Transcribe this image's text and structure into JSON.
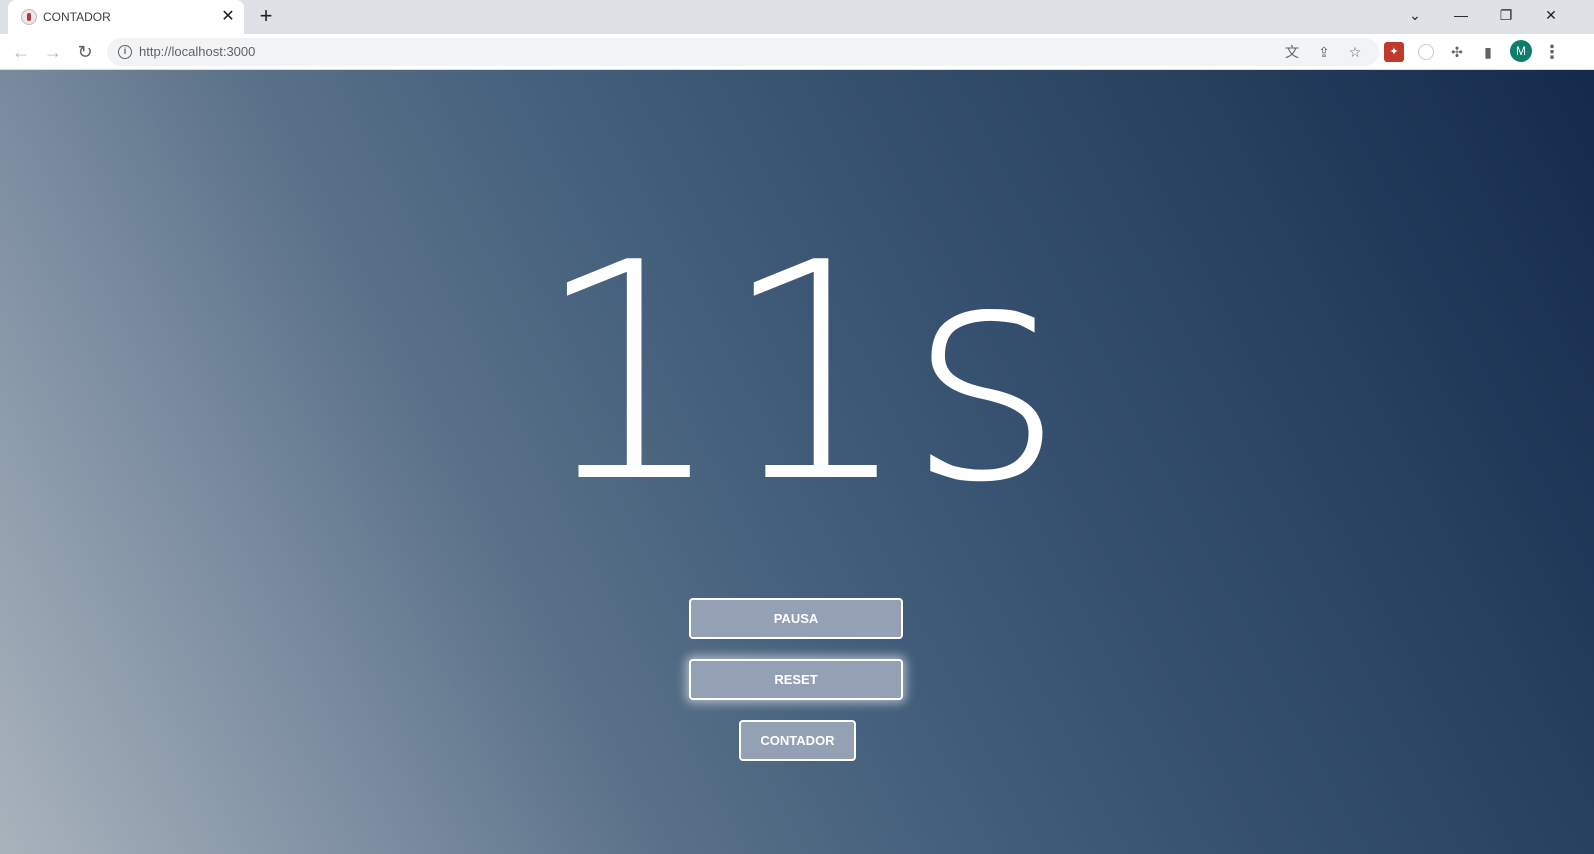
{
  "browser": {
    "tab": {
      "title": "CONTADOR",
      "favicon": "app-favicon",
      "close_glyph": "✕"
    },
    "new_tab_glyph": "+",
    "window_controls": {
      "dropdown_glyph": "⌄",
      "minimize_glyph": "—",
      "restore_glyph": "❐",
      "close_glyph": "✕"
    },
    "toolbar": {
      "back_glyph": "←",
      "forward_glyph": "→",
      "reload_glyph": "↻",
      "url": "http://localhost:3000",
      "info_glyph": "i",
      "translate_glyph": "文",
      "share_glyph": "⇪",
      "bookmark_glyph": "☆",
      "extensions_glyph": "✣",
      "sidepanel_glyph": "▮",
      "avatar_letter": "M",
      "menu_glyph": "⋮"
    }
  },
  "app": {
    "counter_display": "11s",
    "buttons": {
      "pause_label": "PAUSA",
      "reset_label": "RESET",
      "counter_label": "CONTADOR"
    },
    "colors": {
      "button_bg": "#94a0b3",
      "gradient_light": "#a9b3bc",
      "gradient_dark": "#142a4d",
      "avatar_bg": "#0d7d6c"
    }
  }
}
